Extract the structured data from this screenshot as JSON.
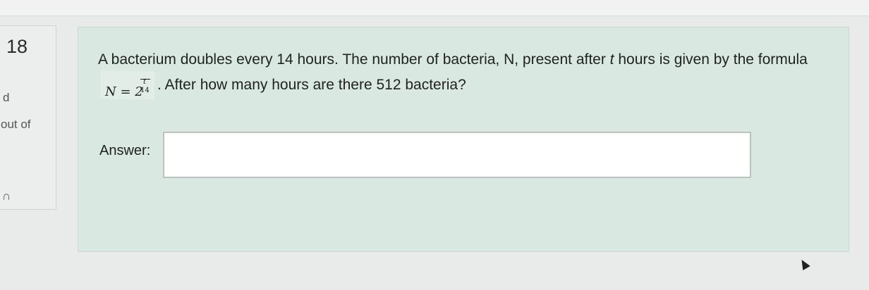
{
  "sidebar": {
    "question_number": "18",
    "status_fragment": "d",
    "points_fragment": "out of",
    "bottom_fragment": "∩"
  },
  "question": {
    "text_part1": "A bacterium doubles every 14 hours.  The number of bacteria, N, present after ",
    "text_var": "t",
    "text_part2": " hours is given by the formula",
    "formula_base": "N = 2",
    "formula_exp_num": "t",
    "formula_exp_den": "14",
    "text_part3": ".  After how many hours are there 512 bacteria?"
  },
  "answer": {
    "label": "Answer:",
    "value": "",
    "placeholder": ""
  }
}
